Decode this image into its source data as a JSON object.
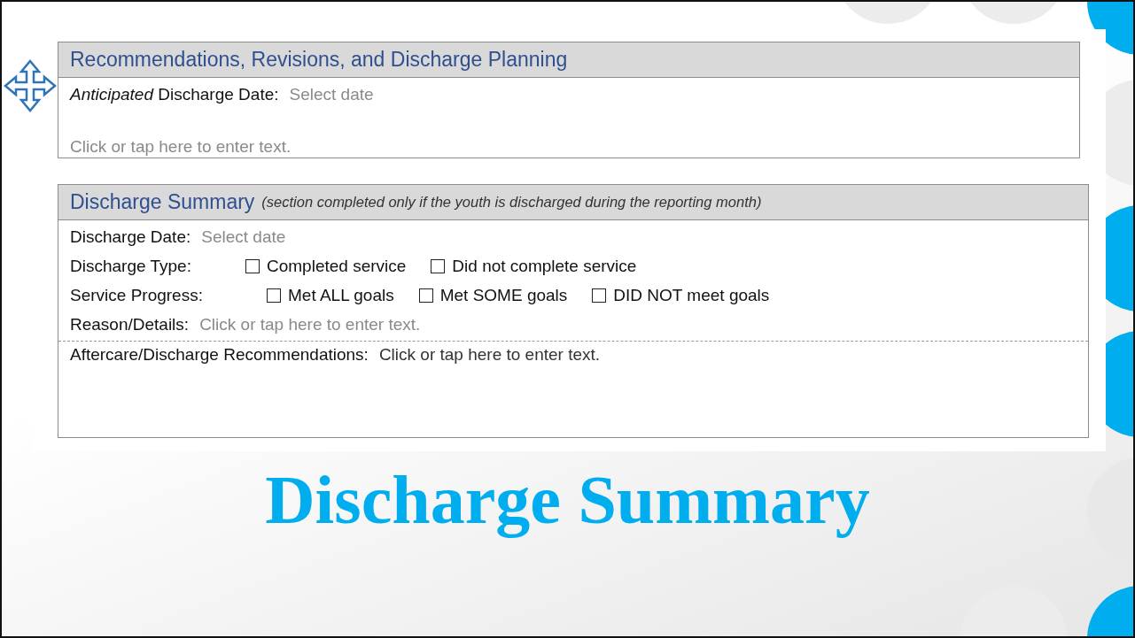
{
  "planning": {
    "title": "Recommendations, Revisions, and Discharge Planning",
    "date_label": "*Anticipated* Discharge Date:",
    "date_placeholder": "Select date",
    "notes_placeholder": "Click or tap here to enter text."
  },
  "summary": {
    "title": "Discharge Summary",
    "note": "(section completed only if the youth is discharged during the reporting month)",
    "date_label": "Discharge Date:",
    "date_placeholder": "Select date",
    "groups": [
      {
        "label": "Discharge Type:",
        "options": [
          {
            "label": "Completed service",
            "checked": false
          },
          {
            "label": "Did not complete service",
            "checked": false
          }
        ]
      },
      {
        "label": "Service Progress:",
        "options": [
          {
            "label": "Met ALL goals",
            "checked": false
          },
          {
            "label": "Met SOME goals",
            "checked": false
          },
          {
            "label": "DID NOT meet goals",
            "checked": false
          }
        ]
      }
    ],
    "reason_label": "Reason/Details:",
    "reason_placeholder": "Click or tap here to enter text.",
    "aftercare_label": "Aftercare/Discharge Recommendations:",
    "aftercare_placeholder": "Click or tap here to enter text."
  },
  "slide_title": "Discharge Summary"
}
